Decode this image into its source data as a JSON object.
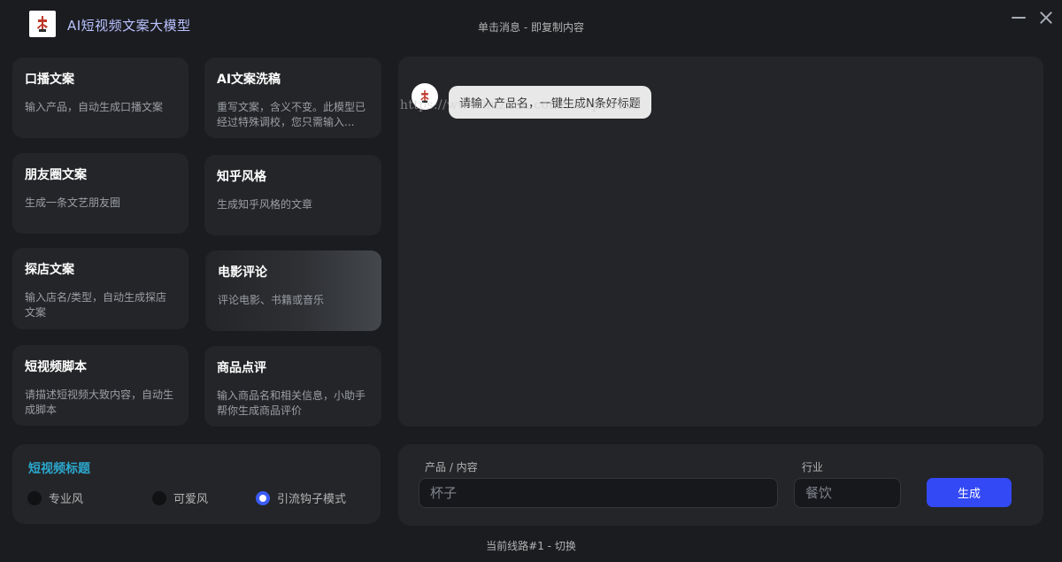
{
  "app": {
    "title": "AⅠ短视频文案大模型",
    "header_hint": "单击消息 - 即复制内容",
    "logo_icon": "red-glyph-logo-icon"
  },
  "cards": [
    {
      "title": "口播文案",
      "desc": "输入产品，自动生成口播文案"
    },
    {
      "title": "AI文案洗稿",
      "desc": "重写文案，含义不变。此模型已经过特殊调校，您只需输入..."
    },
    {
      "title": "朋友圈文案",
      "desc": "生成一条文艺朋友圈"
    },
    {
      "title": "知乎风格",
      "desc": "生成知乎风格的文章"
    },
    {
      "title": "探店文案",
      "desc": "输入店名/类型，自动生成探店文案"
    },
    {
      "title": "电影评论",
      "desc": "评论电影、书籍或音乐"
    },
    {
      "title": "短视频脚本",
      "desc": "请描述短视频大致内容，自动生成脚本"
    },
    {
      "title": "商品点评",
      "desc": "输入商品名和相关信息，小助手帮你生成商品评价"
    }
  ],
  "mode": {
    "title": "短视频标题",
    "options": [
      "专业风",
      "可爱风",
      "引流钩子模式"
    ],
    "selected": "引流钩子模式"
  },
  "chat": {
    "message": "请输入产品名，一键生成N条好标题",
    "watermark": "https://www.huzhan.com/ishop34125"
  },
  "form": {
    "product_label": "产品 / 内容",
    "product_placeholder": "杯子",
    "industry_label": "行业",
    "industry_placeholder": "餐饮",
    "generate_label": "生成"
  },
  "footer": {
    "line_status": "当前线路#1 - 切换"
  },
  "colors": {
    "background": "#1b1c20",
    "panel": "#242528",
    "accent_blue": "#3349f5",
    "mode_title": "#2ba8ce",
    "title_text": "#b9c2ff"
  }
}
